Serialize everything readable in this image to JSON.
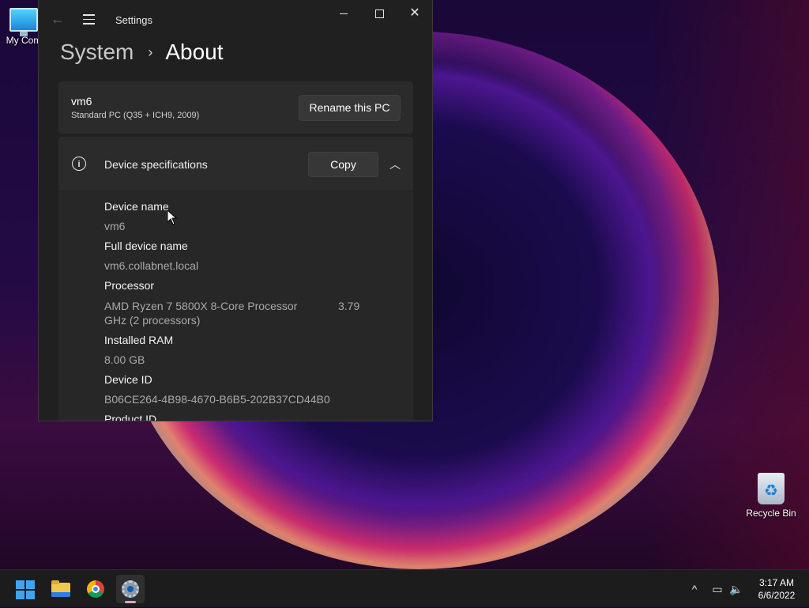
{
  "desktop": {
    "icons": [
      {
        "label": "My Com"
      },
      {
        "label": "Recycle Bin"
      }
    ]
  },
  "window": {
    "title": "Settings",
    "controls": {
      "minimize": "minimize",
      "maximize": "maximize",
      "close": "close"
    }
  },
  "breadcrumb": {
    "parent": "System",
    "separator": "›",
    "current": "About"
  },
  "pc_card": {
    "name": "vm6",
    "model": "Standard PC (Q35 + ICH9, 2009)",
    "rename_label": "Rename this PC"
  },
  "device_specs": {
    "title": "Device specifications",
    "copy_label": "Copy",
    "rows": [
      {
        "label": "Device name",
        "value": "vm6"
      },
      {
        "label": "Full device name",
        "value": "vm6.collabnet.local"
      },
      {
        "label": "Processor",
        "value_line1": "AMD Ryzen 7 5800X 8-Core Processor",
        "value_extra": "3.79",
        "value_line2": "GHz  (2 processors)"
      },
      {
        "label": "Installed RAM",
        "value": "8.00 GB"
      },
      {
        "label": "Device ID",
        "value": "B06CE264-4B98-4670-B6B5-202B37CD44B0"
      },
      {
        "label": "Product ID"
      }
    ]
  },
  "taskbar": {
    "apps": [
      "start",
      "file-explorer",
      "chrome",
      "settings"
    ],
    "tray_up": "^",
    "clock": {
      "time": "3:17 AM",
      "date": "6/6/2022"
    }
  },
  "colors": {
    "window_bg": "#202020",
    "card_bg": "#2b2b2b",
    "accent_blue": "#3ea4f0"
  }
}
